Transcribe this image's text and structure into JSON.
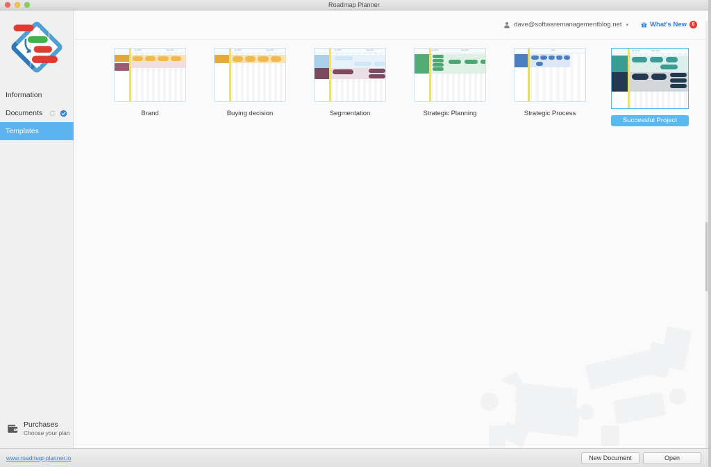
{
  "window": {
    "title": "Roadmap Planner",
    "traffic_lights": [
      "close",
      "minimize",
      "zoom"
    ]
  },
  "sidebar": {
    "logo_name": "roadmap-planner-logo",
    "items": [
      {
        "label": "Information",
        "active": false,
        "icons": []
      },
      {
        "label": "Documents",
        "active": false,
        "icons": [
          "sync-icon",
          "check-circle-icon"
        ]
      },
      {
        "label": "Templates",
        "active": true,
        "icons": []
      }
    ],
    "purchases": {
      "icon": "wallet-icon",
      "title": "Purchases",
      "subtitle": "Choose your plan"
    }
  },
  "header": {
    "account_icon": "person-icon",
    "account_email": "dave@softwaremanagementblog.net",
    "account_caret": "▾",
    "whats_new_icon": "gift-icon",
    "whats_new_label": "What's New",
    "whats_new_badge": "6",
    "accent_color": "#2f7fd4",
    "badge_color": "#e8382c"
  },
  "templates": {
    "items": [
      {
        "label": "Brand",
        "selected": false,
        "accent": "#e8b14c",
        "lane_colors": [
          "#e0a73f",
          "#9c5b72"
        ],
        "ruler_ticks": [
          "Jan 2016",
          "May 2016"
        ]
      },
      {
        "label": "Buying decision",
        "selected": false,
        "accent": "#eeaa3c",
        "lane_colors": [
          "#eba93c"
        ],
        "ruler_ticks": [
          "Jan 2016",
          "May 2016"
        ]
      },
      {
        "label": "Segmentation",
        "selected": false,
        "accent": "#8fc3e8",
        "lane_colors": [
          "#a9cfea",
          "#7b4a5e"
        ],
        "ruler_ticks": [
          "Jan 2016",
          "May 2016"
        ]
      },
      {
        "label": "Strategic Planning",
        "selected": false,
        "accent": "#5cb37f",
        "lane_colors": [
          "#54ab78"
        ],
        "ruler_ticks": [
          "Jan 2016",
          "May 2016"
        ]
      },
      {
        "label": "Strategic Process",
        "selected": false,
        "accent": "#4a7fc1",
        "lane_colors": [
          "#4a7fc1"
        ],
        "ruler_ticks": [
          "2016"
        ]
      },
      {
        "label": "Successful Project",
        "selected": true,
        "accent": "#3a9c92",
        "lane_colors": [
          "#3a9c92",
          "#22394f"
        ],
        "ruler_ticks": [
          "Jan 2016",
          "May 2016"
        ]
      }
    ],
    "selected_label": "Successful Project",
    "selection_color": "#5cb9ee"
  },
  "footer": {
    "site_link": "www.roadmap-planner.io",
    "buttons": [
      {
        "label": "New Document"
      },
      {
        "label": "Open"
      }
    ]
  }
}
